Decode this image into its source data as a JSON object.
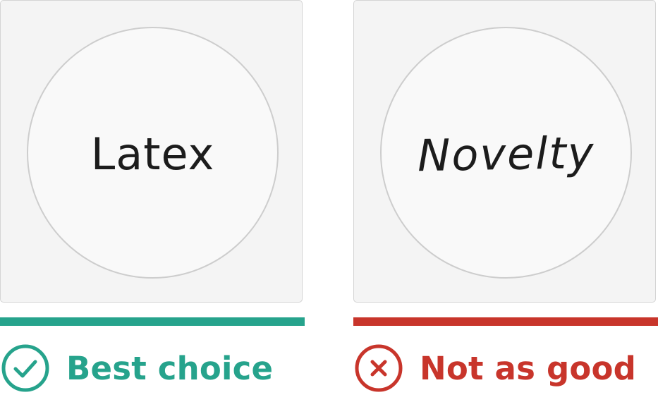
{
  "comparison": {
    "good": {
      "sample_text": "Latex",
      "verdict": "Best choice",
      "color": "#26a38c",
      "icon": "check-circle-icon"
    },
    "bad": {
      "sample_text": "Novelty",
      "verdict": "Not as good",
      "color": "#c8352b",
      "icon": "x-circle-icon"
    }
  }
}
